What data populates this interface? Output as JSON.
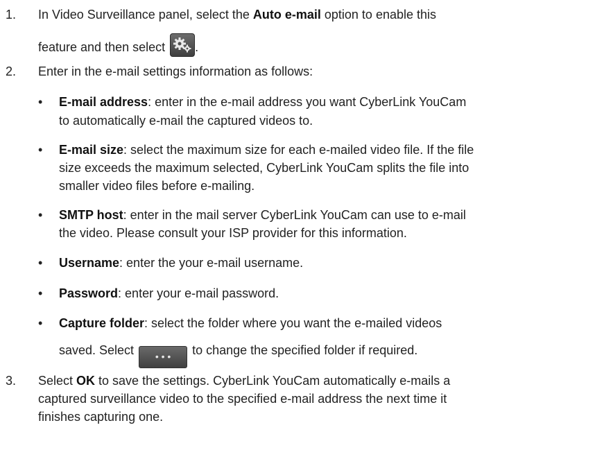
{
  "steps": [
    {
      "num": "1.",
      "a": "In Video Surveillance panel, select the ",
      "bold": "Auto e-mail",
      "b": " option to enable this",
      "c": "feature and then select ",
      "d": "."
    },
    {
      "num": "2.",
      "text": "Enter in the e-mail settings information as follows:"
    },
    {
      "num": "3.",
      "a": "Select ",
      "bold": "OK",
      "b": " to save the settings. CyberLink YouCam automatically e-mails a",
      "c": "captured surveillance video to the specified e-mail address the next time it",
      "d": "finishes capturing one."
    }
  ],
  "bullets": [
    {
      "bold": "E-mail address",
      "l1": ": enter in the e-mail address you want CyberLink YouCam",
      "l2": "to automatically e-mail the captured videos to."
    },
    {
      "bold": "E-mail size",
      "l1": ": select the maximum size for each e-mailed video file. If the file",
      "l2": "size exceeds the maximum selected, CyberLink YouCam splits the file into",
      "l3": "smaller video files before e-mailing."
    },
    {
      "bold": "SMTP host",
      "l1": ": enter in the mail server CyberLink YouCam can use to e-mail",
      "l2": "the video. Please consult your ISP provider for this information."
    },
    {
      "bold": "Username",
      "l1": ": enter the your e-mail username."
    },
    {
      "bold": "Password",
      "l1": ": enter your e-mail password."
    },
    {
      "bold": "Capture folder",
      "l1": ": select the folder where you want the e-mailed videos",
      "l2a": "saved. Select ",
      "l2b": " to change the specified folder if required."
    }
  ],
  "bullet_glyph": "•",
  "icons": {
    "settings_button": "gear-settings-icon",
    "browse_button_label": "• • •"
  }
}
